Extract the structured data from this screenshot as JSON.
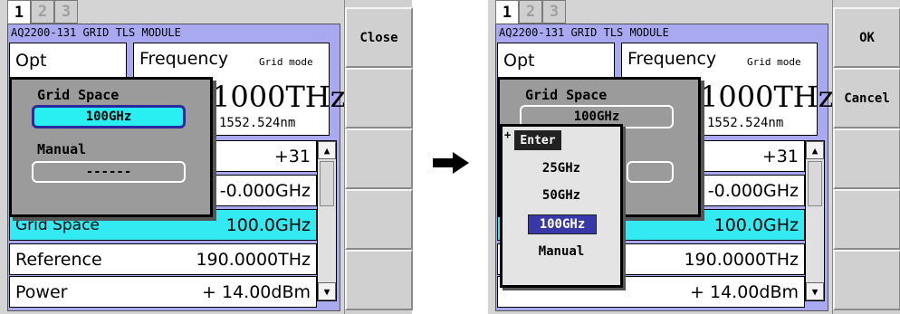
{
  "left": {
    "tabs": [
      "1",
      "2",
      "3"
    ],
    "module_title": "AQ2200-131 GRID TLS MODULE",
    "opt_label": "Opt",
    "freq_label": "Frequency",
    "freq_mode": "Grid mode",
    "freq_value": "1000THz",
    "wavelength": "1552.524nm",
    "rows": [
      {
        "label": "",
        "value": "+31"
      },
      {
        "label": "",
        "value": "-0.000GHz"
      },
      {
        "label": "Grid Space",
        "value": "100.0GHz"
      },
      {
        "label": "Reference",
        "value": "190.0000THz"
      },
      {
        "label": "Power",
        "value": "+ 14.00dBm"
      }
    ],
    "side_button": "Close",
    "popup": {
      "grid_space_label": "Grid Space",
      "grid_space_value": "100GHz",
      "manual_label": "Manual",
      "manual_value": "------"
    }
  },
  "right": {
    "tabs": [
      "1",
      "2",
      "3"
    ],
    "module_title": "AQ2200-131 GRID TLS MODULE",
    "opt_label": "Opt",
    "freq_label": "Frequency",
    "freq_mode": "Grid mode",
    "freq_value": "1000THz",
    "wavelength": "1552.524nm",
    "rows": [
      {
        "label": "",
        "value": "+31"
      },
      {
        "label": "",
        "value": "-0.000GHz"
      },
      {
        "label": "",
        "value": "100.0GHz"
      },
      {
        "label": "",
        "value": "190.0000THz"
      },
      {
        "label": "",
        "value": "+ 14.00dBm"
      }
    ],
    "side_ok": "OK",
    "side_cancel": "Cancel",
    "popup": {
      "grid_space_label": "Grid Space",
      "grid_space_value": "100GHz"
    },
    "menu": {
      "title": "Enter",
      "items": [
        "25GHz",
        "50GHz",
        "100GHz",
        "Manual"
      ],
      "selected": "100GHz"
    }
  },
  "arrow_icon": "right-arrow-icon",
  "colors": {
    "panel": "#a9a9f2",
    "highlight": "#33eaf2",
    "menu_selected": "#3838a8"
  }
}
